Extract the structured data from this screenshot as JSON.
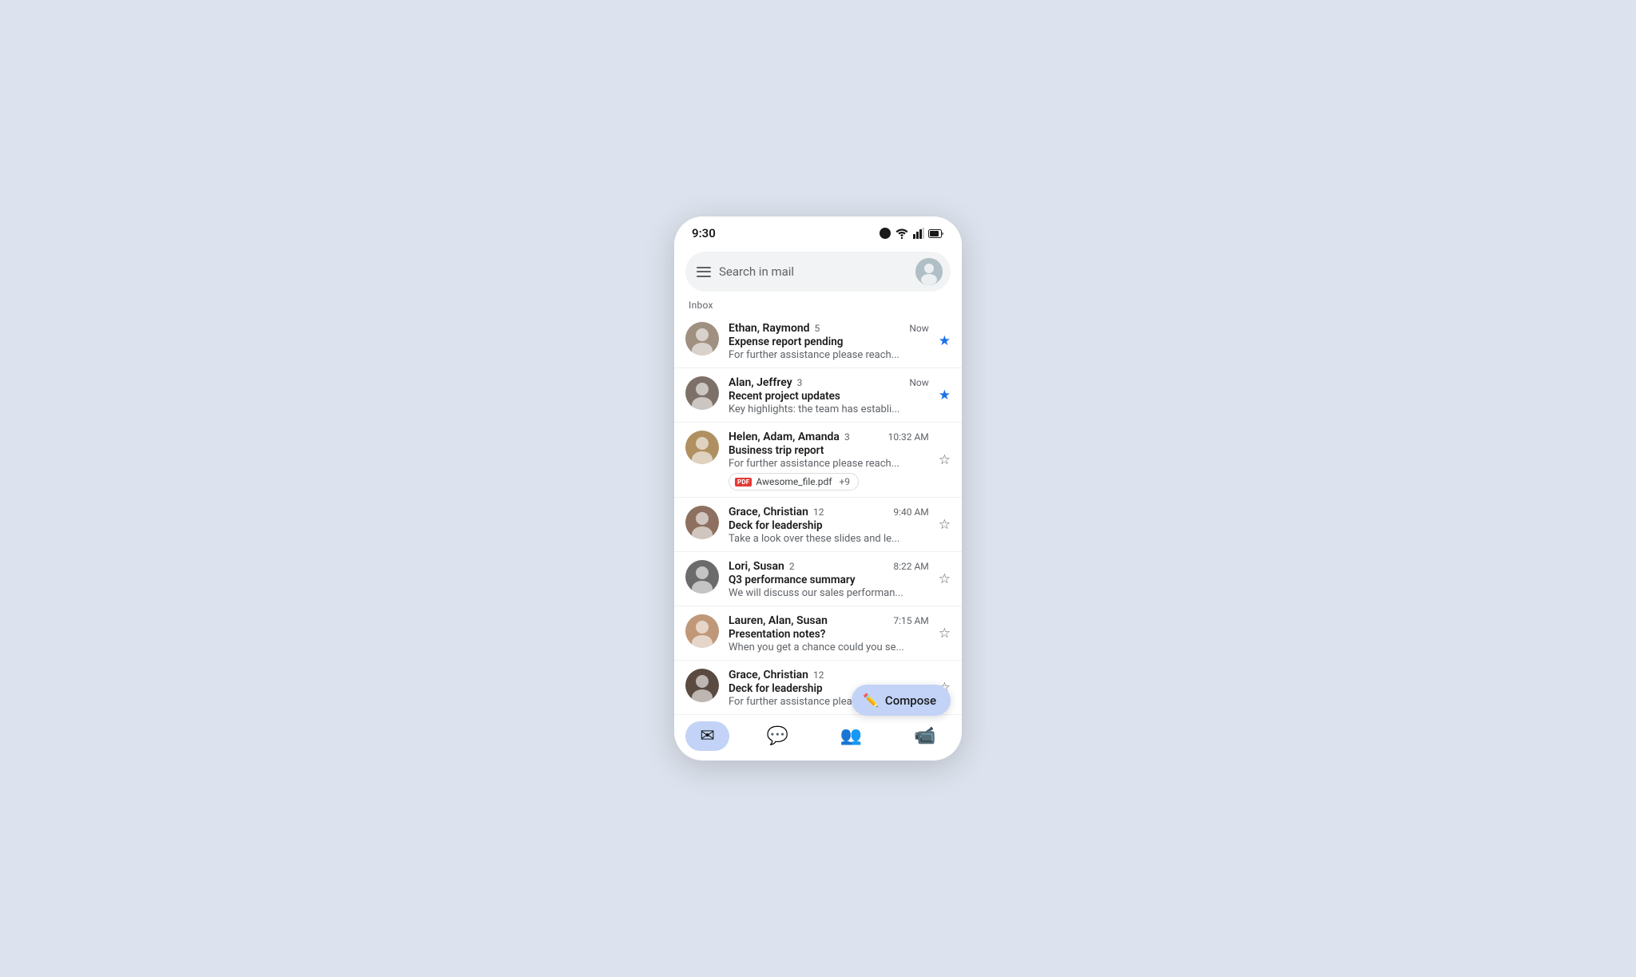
{
  "status": {
    "time": "9:30"
  },
  "search": {
    "placeholder": "Search in mail"
  },
  "section": {
    "inbox_label": "Inbox"
  },
  "emails": [
    {
      "id": 1,
      "sender": "Ethan, Raymond",
      "count": "5",
      "time": "Now",
      "subject": "Expense report pending",
      "preview": "For further assistance please reach...",
      "starred": true,
      "avatar_color": "#a09080"
    },
    {
      "id": 2,
      "sender": "Alan, Jeffrey",
      "count": "3",
      "time": "Now",
      "subject": "Recent project updates",
      "preview": "Key highlights: the team has establi...",
      "starred": true,
      "avatar_color": "#7d7068"
    },
    {
      "id": 3,
      "sender": "Helen, Adam, Amanda",
      "count": "3",
      "time": "10:32 AM",
      "subject": "Business trip report",
      "preview": "For further assistance please reach...",
      "starred": false,
      "avatar_color": "#b09060",
      "attachment": "Awesome_file.pdf",
      "attachment_extra": "+9"
    },
    {
      "id": 4,
      "sender": "Grace, Christian",
      "count": "12",
      "time": "9:40 AM",
      "subject": "Deck for leadership",
      "preview": "Take a look over these slides and le...",
      "starred": false,
      "avatar_color": "#8d7060"
    },
    {
      "id": 5,
      "sender": "Lori, Susan",
      "count": "2",
      "time": "8:22 AM",
      "subject": "Q3 performance summary",
      "preview": "We will discuss our sales performan...",
      "starred": false,
      "avatar_color": "#6b6b6b"
    },
    {
      "id": 6,
      "sender": "Lauren, Alan, Susan",
      "count": "",
      "time": "7:15 AM",
      "subject": "Presentation notes?",
      "preview": "When you get a chance could you se...",
      "starred": false,
      "avatar_color": "#c09878"
    },
    {
      "id": 7,
      "sender": "Grace, Christian",
      "count": "12",
      "time": "",
      "subject": "Deck for leadership",
      "preview": "For further assistance please reac...",
      "starred": false,
      "avatar_color": "#5a4a40"
    }
  ],
  "compose": {
    "label": "Compose"
  },
  "bottom_nav": {
    "mail_label": "Mail",
    "chat_label": "Chat",
    "spaces_label": "Spaces",
    "meet_label": "Meet"
  }
}
